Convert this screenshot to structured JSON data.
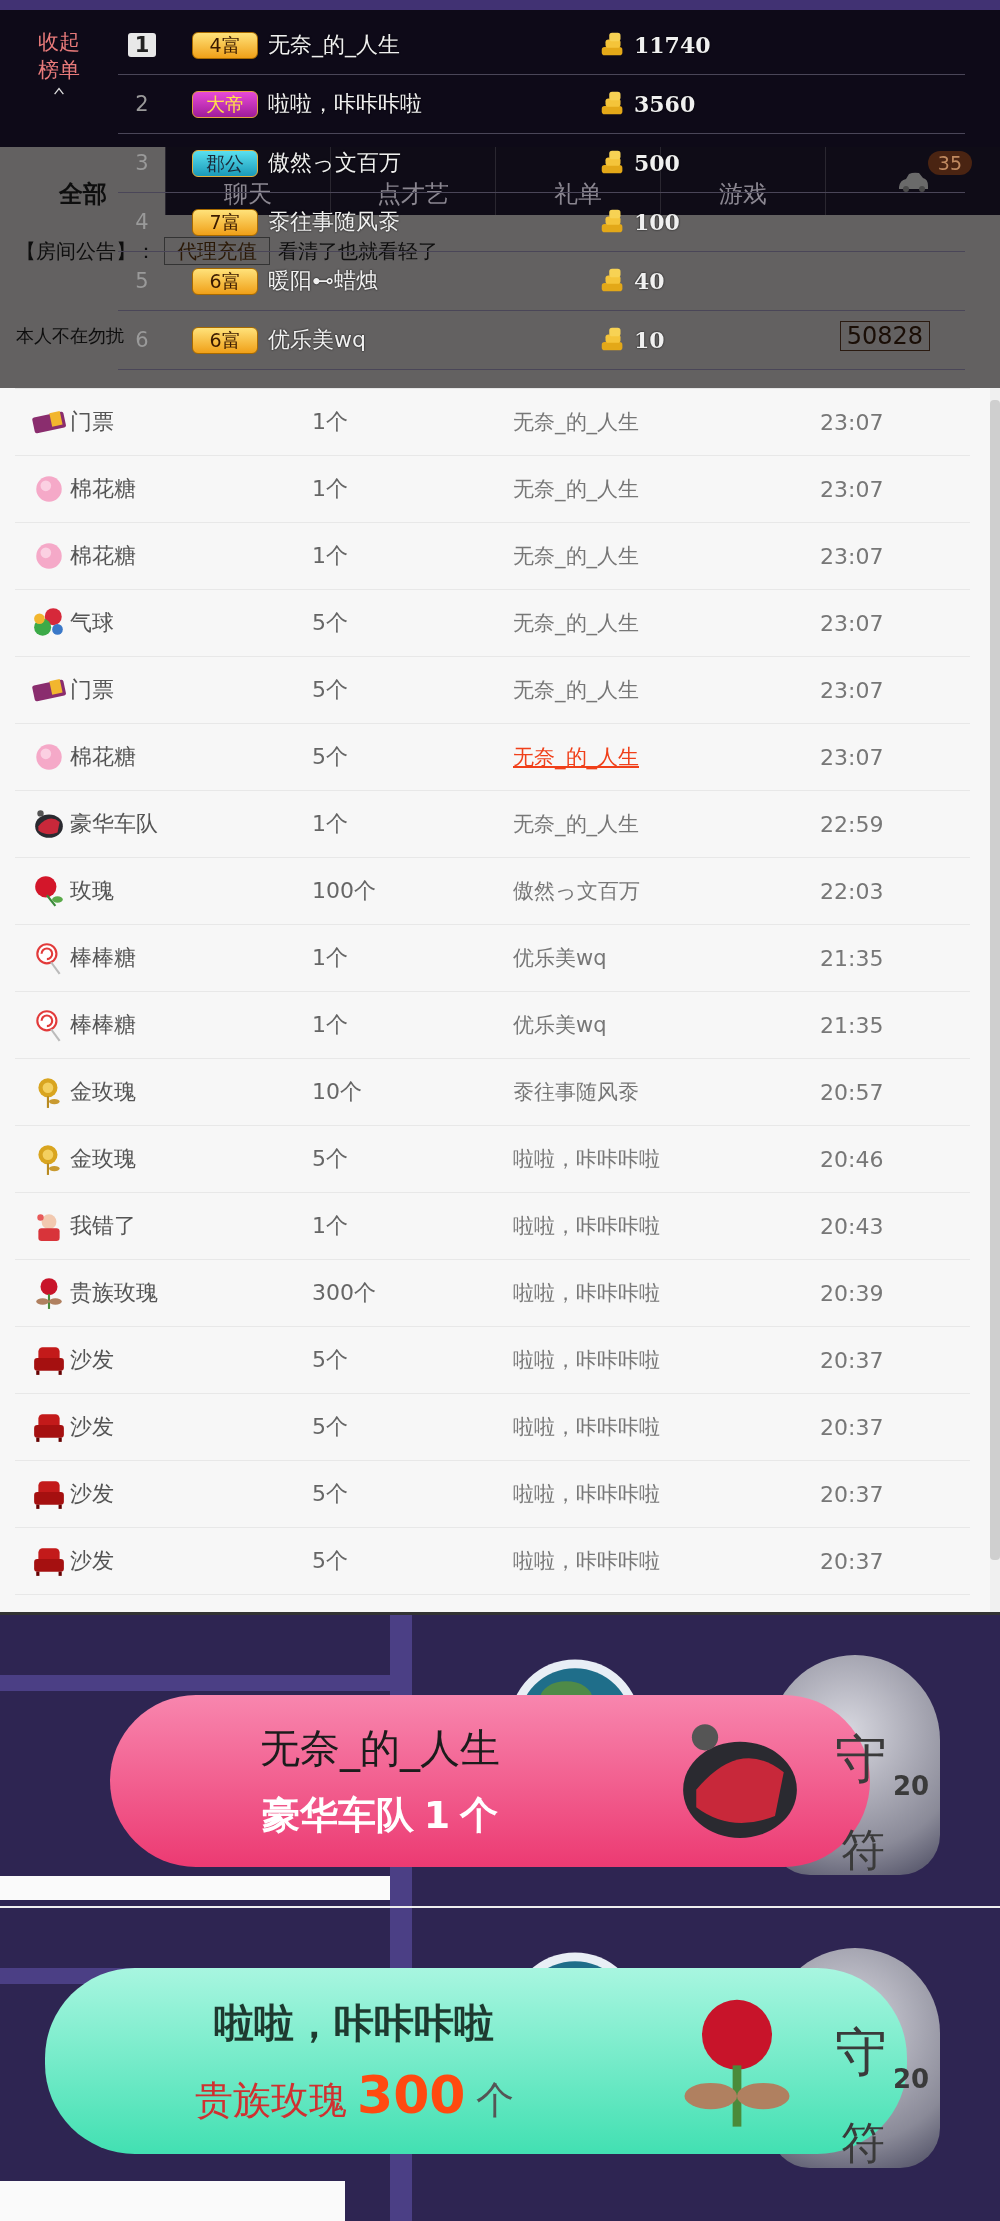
{
  "room_view": {
    "tabs": [
      {
        "label": "全部",
        "selected": true
      },
      {
        "label": "聊天",
        "selected": false
      },
      {
        "label": "点才艺",
        "selected": false
      },
      {
        "label": "礼单",
        "selected": false
      },
      {
        "label": "游戏",
        "selected": false
      }
    ],
    "car_count": "35",
    "announcement": {
      "label": "【房间公告】：",
      "button": "代理充值",
      "text": "看清了也就看轻了"
    },
    "status": "本人不在勿扰",
    "counter": "50828",
    "leaderboard": {
      "collapse_label": "收起榜单",
      "rows": [
        {
          "rank": "1",
          "top": true,
          "title": "4富",
          "kind": "fu",
          "name": "无奈_的_人生",
          "coins": "11740"
        },
        {
          "rank": "2",
          "top": false,
          "title": "大帝",
          "kind": "di",
          "name": "啦啦，咔咔咔啦",
          "coins": "3560"
        },
        {
          "rank": "3",
          "top": false,
          "title": "郡公",
          "kind": "gong",
          "name": "傲然っ文百万",
          "coins": "500"
        },
        {
          "rank": "4",
          "top": false,
          "title": "7富",
          "kind": "fu",
          "name": "沗往事随风沗",
          "coins": "100"
        },
        {
          "rank": "5",
          "top": false,
          "title": "6富",
          "kind": "fu",
          "name": "暖阳⊷蜡烛",
          "coins": "40"
        },
        {
          "rank": "6",
          "top": false,
          "title": "6富",
          "kind": "fu",
          "name": "优乐美wq",
          "coins": "10"
        }
      ]
    }
  },
  "gift_list": {
    "rows": [
      {
        "kind": "ticket",
        "gift": "门票",
        "count": "1个",
        "sender": "无奈_的_人生",
        "time": "23:07",
        "hovered": false
      },
      {
        "kind": "candy",
        "gift": "棉花糖",
        "count": "1个",
        "sender": "无奈_的_人生",
        "time": "23:07",
        "hovered": false
      },
      {
        "kind": "candy",
        "gift": "棉花糖",
        "count": "1个",
        "sender": "无奈_的_人生",
        "time": "23:07",
        "hovered": false
      },
      {
        "kind": "balloon",
        "gift": "气球",
        "count": "5个",
        "sender": "无奈_的_人生",
        "time": "23:07",
        "hovered": false
      },
      {
        "kind": "ticket",
        "gift": "门票",
        "count": "5个",
        "sender": "无奈_的_人生",
        "time": "23:07",
        "hovered": false
      },
      {
        "kind": "candy",
        "gift": "棉花糖",
        "count": "5个",
        "sender": "无奈_的_人生",
        "time": "23:07",
        "hovered": true
      },
      {
        "kind": "car",
        "gift": "豪华车队",
        "count": "1个",
        "sender": "无奈_的_人生",
        "time": "22:59",
        "hovered": false
      },
      {
        "kind": "rose",
        "gift": "玫瑰",
        "count": "100个",
        "sender": "傲然っ文百万",
        "time": "22:03",
        "hovered": false
      },
      {
        "kind": "lollipop",
        "gift": "棒棒糖",
        "count": "1个",
        "sender": "优乐美wq",
        "time": "21:35",
        "hovered": false
      },
      {
        "kind": "lollipop",
        "gift": "棒棒糖",
        "count": "1个",
        "sender": "优乐美wq",
        "time": "21:35",
        "hovered": false
      },
      {
        "kind": "goldrose",
        "gift": "金玫瑰",
        "count": "10个",
        "sender": "沗往事随风沗",
        "time": "20:57",
        "hovered": false
      },
      {
        "kind": "goldrose",
        "gift": "金玫瑰",
        "count": "5个",
        "sender": "啦啦，咔咔咔啦",
        "time": "20:46",
        "hovered": false
      },
      {
        "kind": "sorry",
        "gift": "我错了",
        "count": "1个",
        "sender": "啦啦，咔咔咔啦",
        "time": "20:43",
        "hovered": false
      },
      {
        "kind": "noblerose",
        "gift": "贵族玫瑰",
        "count": "300个",
        "sender": "啦啦，咔咔咔啦",
        "time": "20:39",
        "hovered": false
      },
      {
        "kind": "sofa",
        "gift": "沙发",
        "count": "5个",
        "sender": "啦啦，咔咔咔啦",
        "time": "20:37",
        "hovered": false
      },
      {
        "kind": "sofa",
        "gift": "沙发",
        "count": "5个",
        "sender": "啦啦，咔咔咔啦",
        "time": "20:37",
        "hovered": false
      },
      {
        "kind": "sofa",
        "gift": "沙发",
        "count": "5个",
        "sender": "啦啦，咔咔咔啦",
        "time": "20:37",
        "hovered": false
      },
      {
        "kind": "sofa",
        "gift": "沙发",
        "count": "5个",
        "sender": "啦啦，咔咔咔啦",
        "time": "20:37",
        "hovered": false
      }
    ]
  },
  "banners": [
    {
      "kind": "pink",
      "sender": "无奈_的_人生",
      "gift": "豪华车队",
      "count": "1",
      "unit": "个",
      "guard": {
        "top": "守",
        "level": "20",
        "bottom": "符"
      }
    },
    {
      "kind": "green",
      "sender": "啦啦，咔咔咔啦",
      "gift": "贵族玫瑰",
      "count": "300",
      "unit": "个",
      "guard": {
        "top": "守",
        "level": "20",
        "bottom": "符"
      }
    }
  ]
}
